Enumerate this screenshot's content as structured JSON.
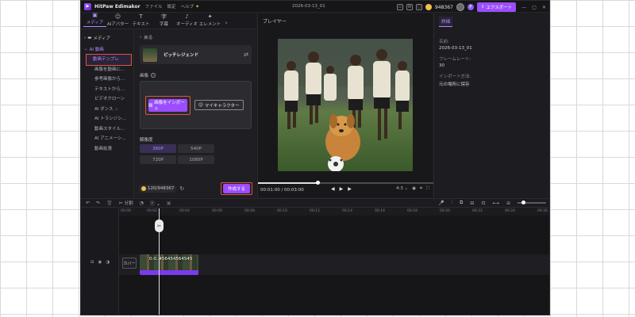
{
  "app": {
    "name": "HitPaw Edimakor",
    "logo_glyph": "▶",
    "menu": [
      "ファイル",
      "設定",
      "ヘルプ"
    ],
    "document_title": "2026-03-13_01",
    "credits": "948367",
    "export_label": "エクスポート",
    "accent_color": "#9b4dff"
  },
  "tabs": [
    {
      "icon": "▣",
      "label": "メディア",
      "active": true
    },
    {
      "icon": "☺",
      "label": "AIアバター"
    },
    {
      "icon": "T",
      "label": "テキスト"
    },
    {
      "icon": "字",
      "label": "字幕"
    },
    {
      "icon": "♪",
      "label": "オーディオ"
    },
    {
      "icon": "✦",
      "label": "エレメント"
    }
  ],
  "leftnav": {
    "categories": [
      {
        "label": "メディア"
      },
      {
        "label": "AI 動画"
      }
    ],
    "subitems": [
      "動画テンプレ",
      "画像を動画に...",
      "参考画像から...",
      "テキストから...",
      "ビデオクローン",
      "AI ダンス",
      "AI トランジシ...",
      "動画スタイル...",
      "AI アニメーシ...",
      "動画拡張"
    ],
    "selected_index": 0
  },
  "midpanel": {
    "back_label": "戻る",
    "template_name": "ピッチレジェンド",
    "image_label": "画像",
    "import_button": "画像をインポート",
    "my_character_button": "マイキャラクター",
    "resolution_label": "解像度",
    "resolutions": [
      "360P",
      "540P",
      "720P",
      "1080P"
    ],
    "selected_resolution": "360P",
    "credit_usage": "120/948367",
    "create_button": "作成する"
  },
  "player": {
    "title": "プレイヤー",
    "timecode": "00:01:00 / 00:03:00",
    "progress": 0.34,
    "aspect": "4:3"
  },
  "details": {
    "tab": "詳細",
    "name_label": "名前:",
    "name_value": "2026-03-13_01",
    "fps_label": "フレームレート:",
    "fps_value": "30",
    "import_label": "インポート方法:",
    "import_value": "元の場所に保存"
  },
  "timeline": {
    "split_label": "分割",
    "ruler": [
      "00:00",
      "00:02",
      "00:04",
      "00:06",
      "00:08",
      "00:10",
      "00:12",
      "00:14",
      "00:16",
      "00:18",
      "00:20",
      "00:22",
      "00:24",
      "00:26"
    ],
    "cover_label": "カバー",
    "clip_label": "0:0..456454564545",
    "zoom_level": 0.15
  }
}
